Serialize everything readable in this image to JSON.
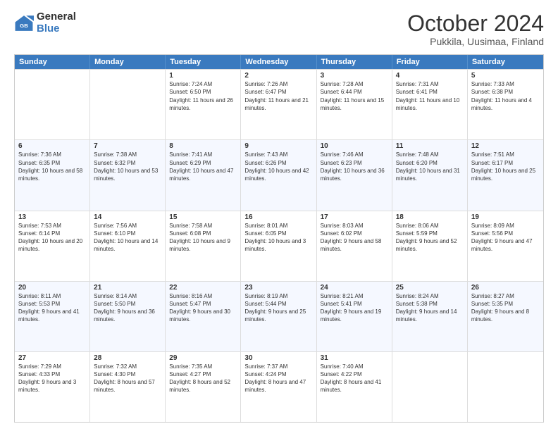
{
  "logo": {
    "general": "General",
    "blue": "Blue"
  },
  "title": "October 2024",
  "location": "Pukkila, Uusimaa, Finland",
  "header_days": [
    "Sunday",
    "Monday",
    "Tuesday",
    "Wednesday",
    "Thursday",
    "Friday",
    "Saturday"
  ],
  "weeks": [
    [
      {
        "day": "",
        "sunrise": "",
        "sunset": "",
        "daylight": ""
      },
      {
        "day": "",
        "sunrise": "",
        "sunset": "",
        "daylight": ""
      },
      {
        "day": "1",
        "sunrise": "Sunrise: 7:24 AM",
        "sunset": "Sunset: 6:50 PM",
        "daylight": "Daylight: 11 hours and 26 minutes."
      },
      {
        "day": "2",
        "sunrise": "Sunrise: 7:26 AM",
        "sunset": "Sunset: 6:47 PM",
        "daylight": "Daylight: 11 hours and 21 minutes."
      },
      {
        "day": "3",
        "sunrise": "Sunrise: 7:28 AM",
        "sunset": "Sunset: 6:44 PM",
        "daylight": "Daylight: 11 hours and 15 minutes."
      },
      {
        "day": "4",
        "sunrise": "Sunrise: 7:31 AM",
        "sunset": "Sunset: 6:41 PM",
        "daylight": "Daylight: 11 hours and 10 minutes."
      },
      {
        "day": "5",
        "sunrise": "Sunrise: 7:33 AM",
        "sunset": "Sunset: 6:38 PM",
        "daylight": "Daylight: 11 hours and 4 minutes."
      }
    ],
    [
      {
        "day": "6",
        "sunrise": "Sunrise: 7:36 AM",
        "sunset": "Sunset: 6:35 PM",
        "daylight": "Daylight: 10 hours and 58 minutes."
      },
      {
        "day": "7",
        "sunrise": "Sunrise: 7:38 AM",
        "sunset": "Sunset: 6:32 PM",
        "daylight": "Daylight: 10 hours and 53 minutes."
      },
      {
        "day": "8",
        "sunrise": "Sunrise: 7:41 AM",
        "sunset": "Sunset: 6:29 PM",
        "daylight": "Daylight: 10 hours and 47 minutes."
      },
      {
        "day": "9",
        "sunrise": "Sunrise: 7:43 AM",
        "sunset": "Sunset: 6:26 PM",
        "daylight": "Daylight: 10 hours and 42 minutes."
      },
      {
        "day": "10",
        "sunrise": "Sunrise: 7:46 AM",
        "sunset": "Sunset: 6:23 PM",
        "daylight": "Daylight: 10 hours and 36 minutes."
      },
      {
        "day": "11",
        "sunrise": "Sunrise: 7:48 AM",
        "sunset": "Sunset: 6:20 PM",
        "daylight": "Daylight: 10 hours and 31 minutes."
      },
      {
        "day": "12",
        "sunrise": "Sunrise: 7:51 AM",
        "sunset": "Sunset: 6:17 PM",
        "daylight": "Daylight: 10 hours and 25 minutes."
      }
    ],
    [
      {
        "day": "13",
        "sunrise": "Sunrise: 7:53 AM",
        "sunset": "Sunset: 6:14 PM",
        "daylight": "Daylight: 10 hours and 20 minutes."
      },
      {
        "day": "14",
        "sunrise": "Sunrise: 7:56 AM",
        "sunset": "Sunset: 6:10 PM",
        "daylight": "Daylight: 10 hours and 14 minutes."
      },
      {
        "day": "15",
        "sunrise": "Sunrise: 7:58 AM",
        "sunset": "Sunset: 6:08 PM",
        "daylight": "Daylight: 10 hours and 9 minutes."
      },
      {
        "day": "16",
        "sunrise": "Sunrise: 8:01 AM",
        "sunset": "Sunset: 6:05 PM",
        "daylight": "Daylight: 10 hours and 3 minutes."
      },
      {
        "day": "17",
        "sunrise": "Sunrise: 8:03 AM",
        "sunset": "Sunset: 6:02 PM",
        "daylight": "Daylight: 9 hours and 58 minutes."
      },
      {
        "day": "18",
        "sunrise": "Sunrise: 8:06 AM",
        "sunset": "Sunset: 5:59 PM",
        "daylight": "Daylight: 9 hours and 52 minutes."
      },
      {
        "day": "19",
        "sunrise": "Sunrise: 8:09 AM",
        "sunset": "Sunset: 5:56 PM",
        "daylight": "Daylight: 9 hours and 47 minutes."
      }
    ],
    [
      {
        "day": "20",
        "sunrise": "Sunrise: 8:11 AM",
        "sunset": "Sunset: 5:53 PM",
        "daylight": "Daylight: 9 hours and 41 minutes."
      },
      {
        "day": "21",
        "sunrise": "Sunrise: 8:14 AM",
        "sunset": "Sunset: 5:50 PM",
        "daylight": "Daylight: 9 hours and 36 minutes."
      },
      {
        "day": "22",
        "sunrise": "Sunrise: 8:16 AM",
        "sunset": "Sunset: 5:47 PM",
        "daylight": "Daylight: 9 hours and 30 minutes."
      },
      {
        "day": "23",
        "sunrise": "Sunrise: 8:19 AM",
        "sunset": "Sunset: 5:44 PM",
        "daylight": "Daylight: 9 hours and 25 minutes."
      },
      {
        "day": "24",
        "sunrise": "Sunrise: 8:21 AM",
        "sunset": "Sunset: 5:41 PM",
        "daylight": "Daylight: 9 hours and 19 minutes."
      },
      {
        "day": "25",
        "sunrise": "Sunrise: 8:24 AM",
        "sunset": "Sunset: 5:38 PM",
        "daylight": "Daylight: 9 hours and 14 minutes."
      },
      {
        "day": "26",
        "sunrise": "Sunrise: 8:27 AM",
        "sunset": "Sunset: 5:35 PM",
        "daylight": "Daylight: 9 hours and 8 minutes."
      }
    ],
    [
      {
        "day": "27",
        "sunrise": "Sunrise: 7:29 AM",
        "sunset": "Sunset: 4:33 PM",
        "daylight": "Daylight: 9 hours and 3 minutes."
      },
      {
        "day": "28",
        "sunrise": "Sunrise: 7:32 AM",
        "sunset": "Sunset: 4:30 PM",
        "daylight": "Daylight: 8 hours and 57 minutes."
      },
      {
        "day": "29",
        "sunrise": "Sunrise: 7:35 AM",
        "sunset": "Sunset: 4:27 PM",
        "daylight": "Daylight: 8 hours and 52 minutes."
      },
      {
        "day": "30",
        "sunrise": "Sunrise: 7:37 AM",
        "sunset": "Sunset: 4:24 PM",
        "daylight": "Daylight: 8 hours and 47 minutes."
      },
      {
        "day": "31",
        "sunrise": "Sunrise: 7:40 AM",
        "sunset": "Sunset: 4:22 PM",
        "daylight": "Daylight: 8 hours and 41 minutes."
      },
      {
        "day": "",
        "sunrise": "",
        "sunset": "",
        "daylight": ""
      },
      {
        "day": "",
        "sunrise": "",
        "sunset": "",
        "daylight": ""
      }
    ]
  ]
}
